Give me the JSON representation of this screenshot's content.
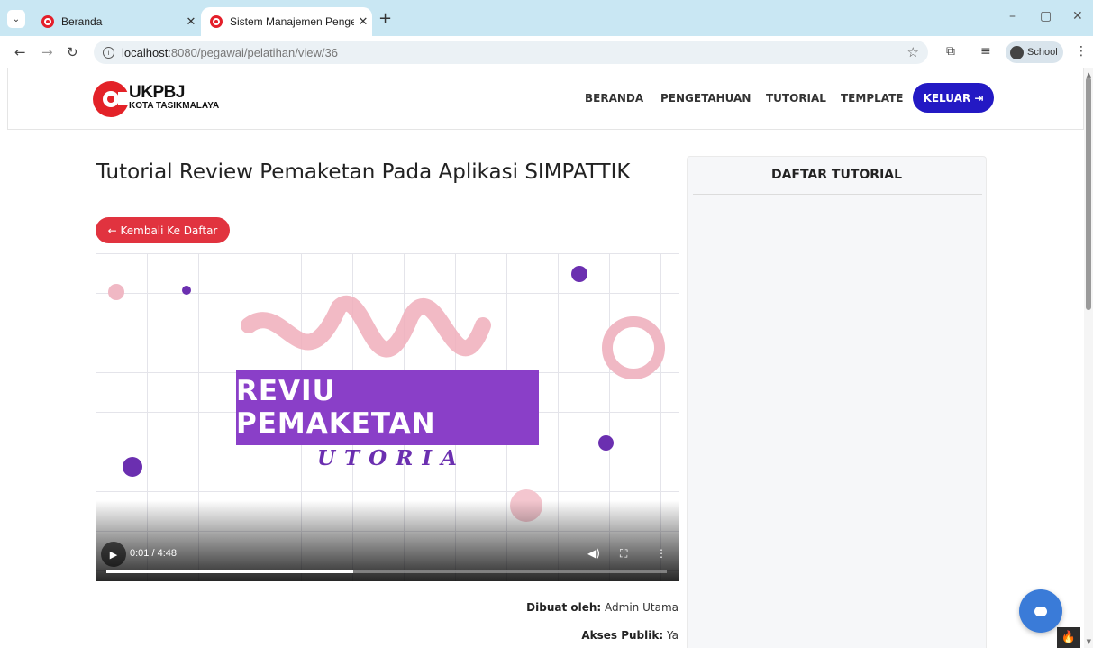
{
  "browser": {
    "tabs": [
      {
        "title": "Beranda",
        "active": false
      },
      {
        "title": "Sistem Manajemen Pengetahua",
        "active": true
      }
    ],
    "new_tab": "+",
    "url_host": "localhost",
    "url_path": ":8080/pegawai/pelatihan/view/36",
    "profile_label": "School",
    "window_controls": {
      "minimize": "–",
      "restore": "▢",
      "close": "✕"
    }
  },
  "header": {
    "logo_title": "UKPBJ",
    "logo_subtitle": "KOTA TASIKMALAYA",
    "nav": [
      "BERANDA",
      "PENGETAHUAN",
      "TUTORIAL",
      "TEMPLATE"
    ],
    "logout_label": "KELUAR ⇥"
  },
  "main": {
    "title": "Tutorial Review Pemaketan Pada Aplikasi SIMPATTIK",
    "back_label": "← Kembali Ke Daftar",
    "video": {
      "banner_text": "REVIU PEMAKETAN",
      "banner_subtext": "UTORIA",
      "time": "0:01 / 4:48",
      "progress": 0.44
    },
    "meta": [
      {
        "label": "Dibuat oleh:",
        "value": "Admin Utama"
      },
      {
        "label": "Akses Publik:",
        "value": "Ya"
      }
    ]
  },
  "sidebar": {
    "title": "DAFTAR TUTORIAL"
  },
  "colors": {
    "tabbar": "#c9e7f3",
    "brand_red": "#e32228",
    "logout_blue": "#2319c4",
    "back_red": "#e1333f",
    "video_purple": "#8a3fc8",
    "chat_blue": "#3a7bd8"
  },
  "icons": {
    "back": "arrow-left-icon",
    "logout": "logout-icon",
    "chat": "chat-icon"
  }
}
